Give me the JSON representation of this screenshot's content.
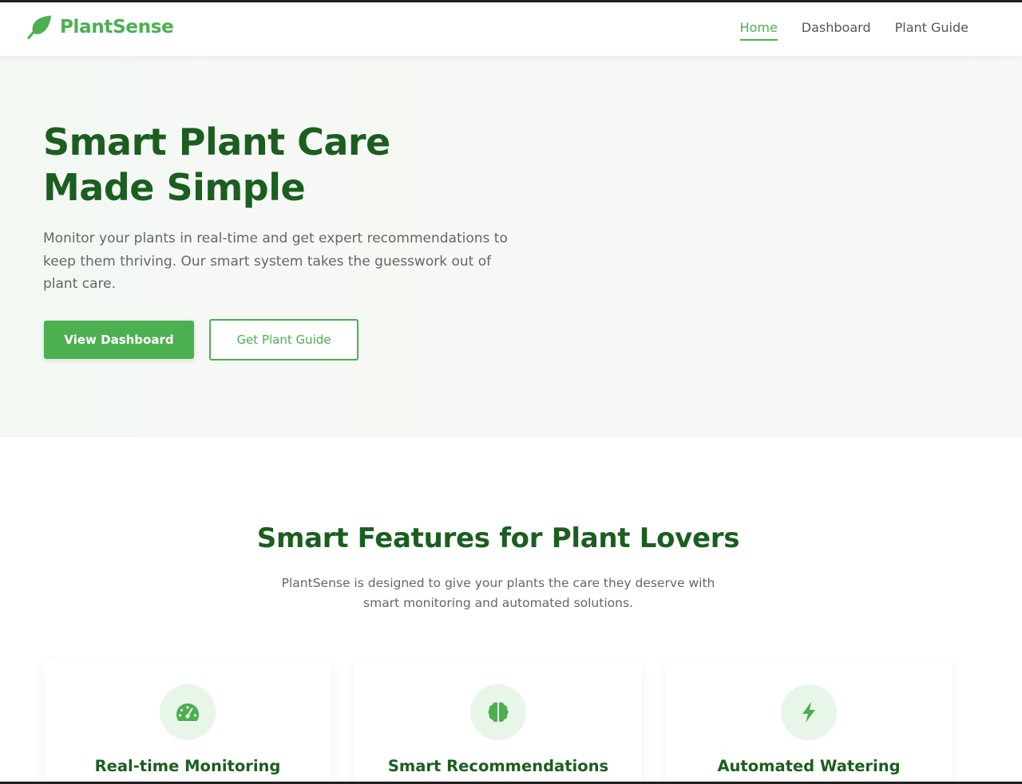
{
  "brand": {
    "name": "PlantSense",
    "icon": "leaf-icon",
    "color": "#4caf50"
  },
  "nav": {
    "links": [
      {
        "label": "Home",
        "active": true
      },
      {
        "label": "Dashboard",
        "active": false
      },
      {
        "label": "Plant Guide",
        "active": false
      }
    ]
  },
  "hero": {
    "title_line1": "Smart Plant Care",
    "title_line2": "Made Simple",
    "description": "Monitor your plants in real-time and get expert recommendations to keep them thriving. Our smart system takes the guesswork out of plant care.",
    "primary_button": "View Dashboard",
    "secondary_button": "Get Plant Guide"
  },
  "features": {
    "title": "Smart Features for Plant Lovers",
    "subtitle": "PlantSense is designed to give your plants the care they deserve with smart monitoring and automated solutions.",
    "cards": [
      {
        "title": "Real-time Monitoring",
        "icon": "gauge-icon"
      },
      {
        "title": "Smart Recommendations",
        "icon": "brain-icon"
      },
      {
        "title": "Automated Watering",
        "icon": "bolt-icon"
      }
    ]
  },
  "colors": {
    "primary": "#4caf50",
    "dark_green": "#1b5e20",
    "icon_bg": "#e8f5e9",
    "hero_bg": "#f5f8f4"
  }
}
